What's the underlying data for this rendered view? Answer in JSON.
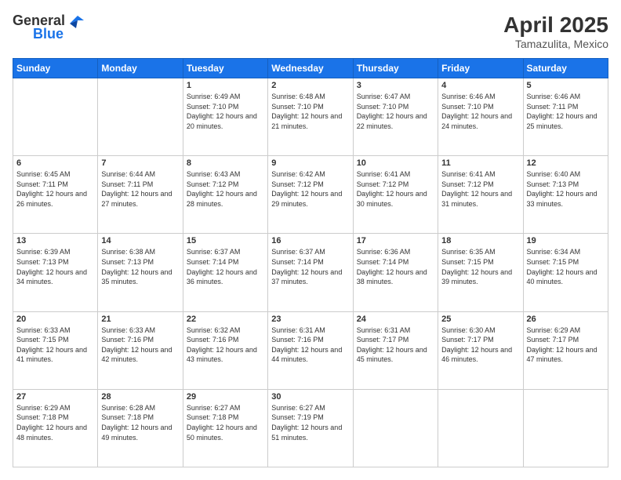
{
  "header": {
    "logo_general": "General",
    "logo_blue": "Blue",
    "month_title": "April 2025",
    "location": "Tamazulita, Mexico"
  },
  "days_of_week": [
    "Sunday",
    "Monday",
    "Tuesday",
    "Wednesday",
    "Thursday",
    "Friday",
    "Saturday"
  ],
  "weeks": [
    [
      {
        "day": "",
        "info": ""
      },
      {
        "day": "",
        "info": ""
      },
      {
        "day": "1",
        "info": "Sunrise: 6:49 AM\nSunset: 7:10 PM\nDaylight: 12 hours and 20 minutes."
      },
      {
        "day": "2",
        "info": "Sunrise: 6:48 AM\nSunset: 7:10 PM\nDaylight: 12 hours and 21 minutes."
      },
      {
        "day": "3",
        "info": "Sunrise: 6:47 AM\nSunset: 7:10 PM\nDaylight: 12 hours and 22 minutes."
      },
      {
        "day": "4",
        "info": "Sunrise: 6:46 AM\nSunset: 7:10 PM\nDaylight: 12 hours and 24 minutes."
      },
      {
        "day": "5",
        "info": "Sunrise: 6:46 AM\nSunset: 7:11 PM\nDaylight: 12 hours and 25 minutes."
      }
    ],
    [
      {
        "day": "6",
        "info": "Sunrise: 6:45 AM\nSunset: 7:11 PM\nDaylight: 12 hours and 26 minutes."
      },
      {
        "day": "7",
        "info": "Sunrise: 6:44 AM\nSunset: 7:11 PM\nDaylight: 12 hours and 27 minutes."
      },
      {
        "day": "8",
        "info": "Sunrise: 6:43 AM\nSunset: 7:12 PM\nDaylight: 12 hours and 28 minutes."
      },
      {
        "day": "9",
        "info": "Sunrise: 6:42 AM\nSunset: 7:12 PM\nDaylight: 12 hours and 29 minutes."
      },
      {
        "day": "10",
        "info": "Sunrise: 6:41 AM\nSunset: 7:12 PM\nDaylight: 12 hours and 30 minutes."
      },
      {
        "day": "11",
        "info": "Sunrise: 6:41 AM\nSunset: 7:12 PM\nDaylight: 12 hours and 31 minutes."
      },
      {
        "day": "12",
        "info": "Sunrise: 6:40 AM\nSunset: 7:13 PM\nDaylight: 12 hours and 33 minutes."
      }
    ],
    [
      {
        "day": "13",
        "info": "Sunrise: 6:39 AM\nSunset: 7:13 PM\nDaylight: 12 hours and 34 minutes."
      },
      {
        "day": "14",
        "info": "Sunrise: 6:38 AM\nSunset: 7:13 PM\nDaylight: 12 hours and 35 minutes."
      },
      {
        "day": "15",
        "info": "Sunrise: 6:37 AM\nSunset: 7:14 PM\nDaylight: 12 hours and 36 minutes."
      },
      {
        "day": "16",
        "info": "Sunrise: 6:37 AM\nSunset: 7:14 PM\nDaylight: 12 hours and 37 minutes."
      },
      {
        "day": "17",
        "info": "Sunrise: 6:36 AM\nSunset: 7:14 PM\nDaylight: 12 hours and 38 minutes."
      },
      {
        "day": "18",
        "info": "Sunrise: 6:35 AM\nSunset: 7:15 PM\nDaylight: 12 hours and 39 minutes."
      },
      {
        "day": "19",
        "info": "Sunrise: 6:34 AM\nSunset: 7:15 PM\nDaylight: 12 hours and 40 minutes."
      }
    ],
    [
      {
        "day": "20",
        "info": "Sunrise: 6:33 AM\nSunset: 7:15 PM\nDaylight: 12 hours and 41 minutes."
      },
      {
        "day": "21",
        "info": "Sunrise: 6:33 AM\nSunset: 7:16 PM\nDaylight: 12 hours and 42 minutes."
      },
      {
        "day": "22",
        "info": "Sunrise: 6:32 AM\nSunset: 7:16 PM\nDaylight: 12 hours and 43 minutes."
      },
      {
        "day": "23",
        "info": "Sunrise: 6:31 AM\nSunset: 7:16 PM\nDaylight: 12 hours and 44 minutes."
      },
      {
        "day": "24",
        "info": "Sunrise: 6:31 AM\nSunset: 7:17 PM\nDaylight: 12 hours and 45 minutes."
      },
      {
        "day": "25",
        "info": "Sunrise: 6:30 AM\nSunset: 7:17 PM\nDaylight: 12 hours and 46 minutes."
      },
      {
        "day": "26",
        "info": "Sunrise: 6:29 AM\nSunset: 7:17 PM\nDaylight: 12 hours and 47 minutes."
      }
    ],
    [
      {
        "day": "27",
        "info": "Sunrise: 6:29 AM\nSunset: 7:18 PM\nDaylight: 12 hours and 48 minutes."
      },
      {
        "day": "28",
        "info": "Sunrise: 6:28 AM\nSunset: 7:18 PM\nDaylight: 12 hours and 49 minutes."
      },
      {
        "day": "29",
        "info": "Sunrise: 6:27 AM\nSunset: 7:18 PM\nDaylight: 12 hours and 50 minutes."
      },
      {
        "day": "30",
        "info": "Sunrise: 6:27 AM\nSunset: 7:19 PM\nDaylight: 12 hours and 51 minutes."
      },
      {
        "day": "",
        "info": ""
      },
      {
        "day": "",
        "info": ""
      },
      {
        "day": "",
        "info": ""
      }
    ]
  ]
}
